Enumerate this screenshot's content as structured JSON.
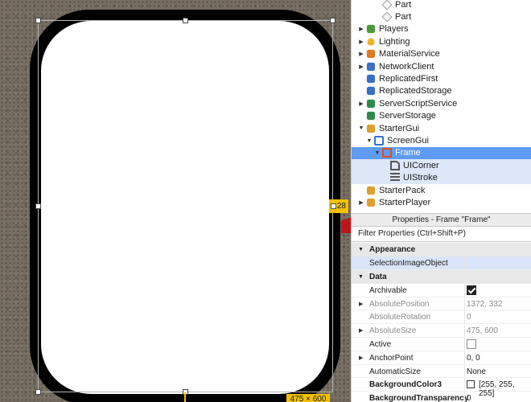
{
  "viewport": {
    "size_badge": "28",
    "dims_badge": "475 × 600"
  },
  "explorer": {
    "items": [
      {
        "label": "Part",
        "icon": "part-icon",
        "expanded": null
      },
      {
        "label": "Part",
        "icon": "part-icon",
        "expanded": null
      },
      {
        "label": "Players",
        "icon": "players-icon",
        "expanded": false
      },
      {
        "label": "Lighting",
        "icon": "lighting-icon",
        "expanded": false
      },
      {
        "label": "MaterialService",
        "icon": "material-service-icon",
        "expanded": false
      },
      {
        "label": "NetworkClient",
        "icon": "network-client-icon",
        "expanded": false
      },
      {
        "label": "ReplicatedFirst",
        "icon": "replicated-first-icon",
        "expanded": null
      },
      {
        "label": "ReplicatedStorage",
        "icon": "replicated-storage-icon",
        "expanded": null
      },
      {
        "label": "ServerScriptService",
        "icon": "server-script-service-icon",
        "expanded": false
      },
      {
        "label": "ServerStorage",
        "icon": "server-storage-icon",
        "expanded": null
      },
      {
        "label": "StarterGui",
        "icon": "starter-gui-icon",
        "expanded": true
      },
      {
        "label": "ScreenGui",
        "icon": "screen-gui-icon",
        "expanded": true
      },
      {
        "label": "Frame",
        "icon": "frame-icon",
        "expanded": true
      },
      {
        "label": "UICorner",
        "icon": "ui-corner-icon",
        "expanded": null
      },
      {
        "label": "UIStroke",
        "icon": "ui-stroke-icon",
        "expanded": null
      },
      {
        "label": "StarterPack",
        "icon": "starter-pack-icon",
        "expanded": null
      },
      {
        "label": "StarterPlayer",
        "icon": "starter-player-icon",
        "expanded": false
      }
    ]
  },
  "properties": {
    "title": "Properties - Frame \"Frame\"",
    "filter_placeholder": "Filter Properties (Ctrl+Shift+P)",
    "sections": [
      {
        "name": "Appearance",
        "rows": [
          {
            "name": "SelectionImageObject",
            "value": ""
          }
        ]
      },
      {
        "name": "Data",
        "rows": [
          {
            "name": "Archivable",
            "value": "",
            "checked": true
          },
          {
            "name": "AbsolutePosition",
            "value": "1372, 332"
          },
          {
            "name": "AbsoluteRotation",
            "value": "0"
          },
          {
            "name": "AbsoluteSize",
            "value": "475, 600"
          },
          {
            "name": "Active",
            "value": "",
            "checked": false
          },
          {
            "name": "AnchorPoint",
            "value": "0, 0"
          },
          {
            "name": "AutomaticSize",
            "value": "None"
          },
          {
            "name": "BackgroundColor3",
            "value": "[255, 255, 255]",
            "color": "#ffffff"
          },
          {
            "name": "BackgroundTransparency",
            "value": "0"
          }
        ]
      }
    ]
  },
  "colors": {
    "selection": "#5e9bf2",
    "badge": "#f2c100",
    "frame_stroke": "#000000",
    "frame_fill": "#ffffff"
  }
}
